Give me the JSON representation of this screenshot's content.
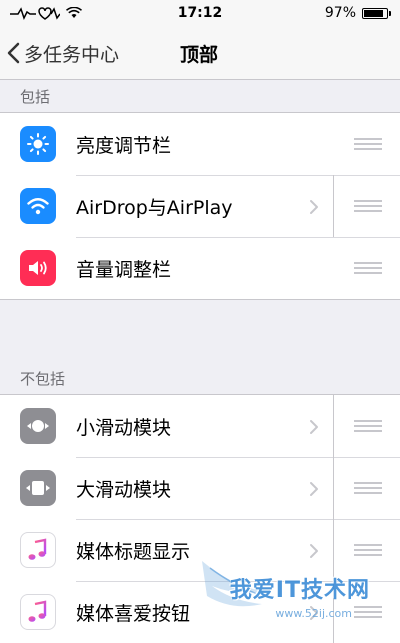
{
  "status_bar": {
    "time": "17:12",
    "battery_percent": "97%",
    "battery_level": 0.97
  },
  "nav": {
    "back_label": "多任务中心",
    "title": "顶部"
  },
  "sections": [
    {
      "header": "包括",
      "items": [
        {
          "label": "亮度调节栏",
          "icon": "sun-icon",
          "color": "#1a8cff",
          "chevron": false
        },
        {
          "label": "AirDrop与AirPlay",
          "icon": "wifi-icon",
          "color": "#1a8cff",
          "chevron": true
        },
        {
          "label": "音量调整栏",
          "icon": "speaker-icon",
          "color": "#ff2d55",
          "chevron": false
        }
      ]
    },
    {
      "header": "不包括",
      "items": [
        {
          "label": "小滑动模块",
          "icon": "small-slider-icon",
          "color": "#8e8e93",
          "chevron": true
        },
        {
          "label": "大滑动模块",
          "icon": "large-slider-icon",
          "color": "#8e8e93",
          "chevron": true
        },
        {
          "label": "媒体标题显示",
          "icon": "music-note-icon",
          "color": "#ffffff",
          "chevron": true
        },
        {
          "label": "媒体喜爱按钮",
          "icon": "music-note-icon",
          "color": "#ffffff",
          "chevron": true
        }
      ]
    }
  ],
  "watermark": {
    "text": "我爱IT技术网",
    "url": "www.52ij.com"
  }
}
